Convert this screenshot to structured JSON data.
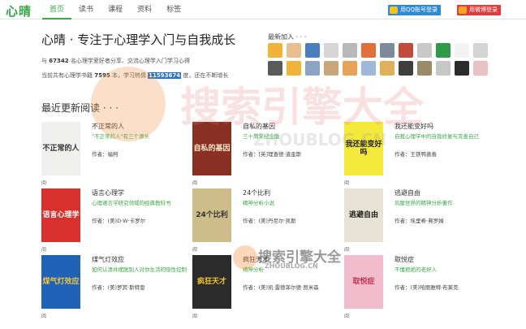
{
  "app": {
    "logo": "心晴"
  },
  "nav": [
    {
      "label": "首页",
      "active": true
    },
    {
      "label": "读书",
      "active": false
    },
    {
      "label": "课程",
      "active": false
    },
    {
      "label": "资料",
      "active": false
    },
    {
      "label": "标签",
      "active": false
    }
  ],
  "login": {
    "qq": "用QQ账号登录",
    "weibo": "用微博登录"
  },
  "hero": {
    "headline": "心晴 · 专注于心理学入门与自我成长",
    "stat1_pre": "与 ",
    "stat1_num": "67342",
    "stat1_post": " 名心理学爱好者分享、交流心理学入门学习心得",
    "stat2_pre": "当前共有心理学书籍 ",
    "stat2_books": "7595",
    "stat2_mid": " 本，学习热情 ",
    "stat2_heat": "11593674",
    "stat2_post": " 度，还在不断增长"
  },
  "recent_users": {
    "title": "最新加入 · · ·",
    "avatars": [
      "#f2b33a",
      "#e8c08f",
      "#4a7fbf",
      "#d6d6d6",
      "#b9b9b9",
      "#e06f39",
      "#7d8a9c",
      "#c24a3a",
      "#c9c9c9",
      "#2f9b4a",
      "#f4f4f4",
      "#d4d4d4",
      "#5a5a5a",
      "#f2b33a",
      "#8da3c6",
      "#c9a77a",
      "#e8a25a",
      "#9fb8d8",
      "#e0b05a",
      "#3f3f3f",
      "#9a8b6d",
      "#c7c7c7",
      "#2c2c2c",
      "#e7c3c8"
    ]
  },
  "section": {
    "title": "最近更新阅读 · · ·"
  },
  "books": [
    {
      "title": "不正常的人",
      "desc": "\"不正常的人\"有三个源头",
      "author": "作者：福柯",
      "cover_text": "不正常的人",
      "cover_bg": "#f0f0ee",
      "cover_fg": "#333333"
    },
    {
      "title": "自私的基因",
      "desc": "三十周年纪念版",
      "author": "作者：[英]理查德·道金斯",
      "cover_text": "自私的基因",
      "cover_bg": "#8a2f23",
      "cover_fg": "#f3e6c8"
    },
    {
      "title": "我还能变好吗",
      "desc": "自我心理学中的自我修复与完善自己",
      "author": "作者：王铁鸭善善",
      "cover_text": "我还能变好吗",
      "cover_bg": "#f4ea3c",
      "cover_fg": "#1e1e1e"
    },
    {
      "title": "语言心理学",
      "desc": "心理语言学研究领域的经典教科书",
      "author": "作者：(美)D·W·卡罗尔",
      "cover_text": "语言心理学",
      "cover_bg": "#d8302c",
      "cover_fg": "#ffffff"
    },
    {
      "title": "24个比利",
      "desc": "精神分析小说",
      "author": "作者：(美)丹尼尔·凯斯",
      "cover_text": "24个比利",
      "cover_bg": "#cdbd8a",
      "cover_fg": "#333333"
    },
    {
      "title": "逃避自由",
      "desc": "风靡世界的精神分析著作",
      "author": "作者：埃里希·弗罗姆",
      "cover_text": "逃避自由",
      "cover_bg": "#e7e3d6",
      "cover_fg": "#222222"
    },
    {
      "title": "煤气灯效应",
      "desc": "如何认清并摆脱别人对你生活的隐性控制",
      "author": "作者：(美)罗宾·斯特恩",
      "cover_text": "煤气灯效应",
      "cover_bg": "#1f63b8",
      "cover_fg": "#f4c23b"
    },
    {
      "title": "疯狂天才",
      "desc": "精神分析",
      "author": "作者：(美)凯·雷德菲尔德·贾米森",
      "cover_text": "疯狂天才",
      "cover_bg": "#2b2b2b",
      "cover_fg": "#f0c030"
    },
    {
      "title": "取悦症",
      "desc": "不懂拒绝的老好人",
      "author": "作者：(美)哈丽雅特·布莱克",
      "cover_text": "取悦症",
      "cover_bg": "#f3bccc",
      "cover_fg": "#c2334f"
    }
  ],
  "read_mark": "阅",
  "watermark": {
    "text_cn": "搜索引擎大全",
    "text_en": "ZHOUBLOG.CN"
  }
}
